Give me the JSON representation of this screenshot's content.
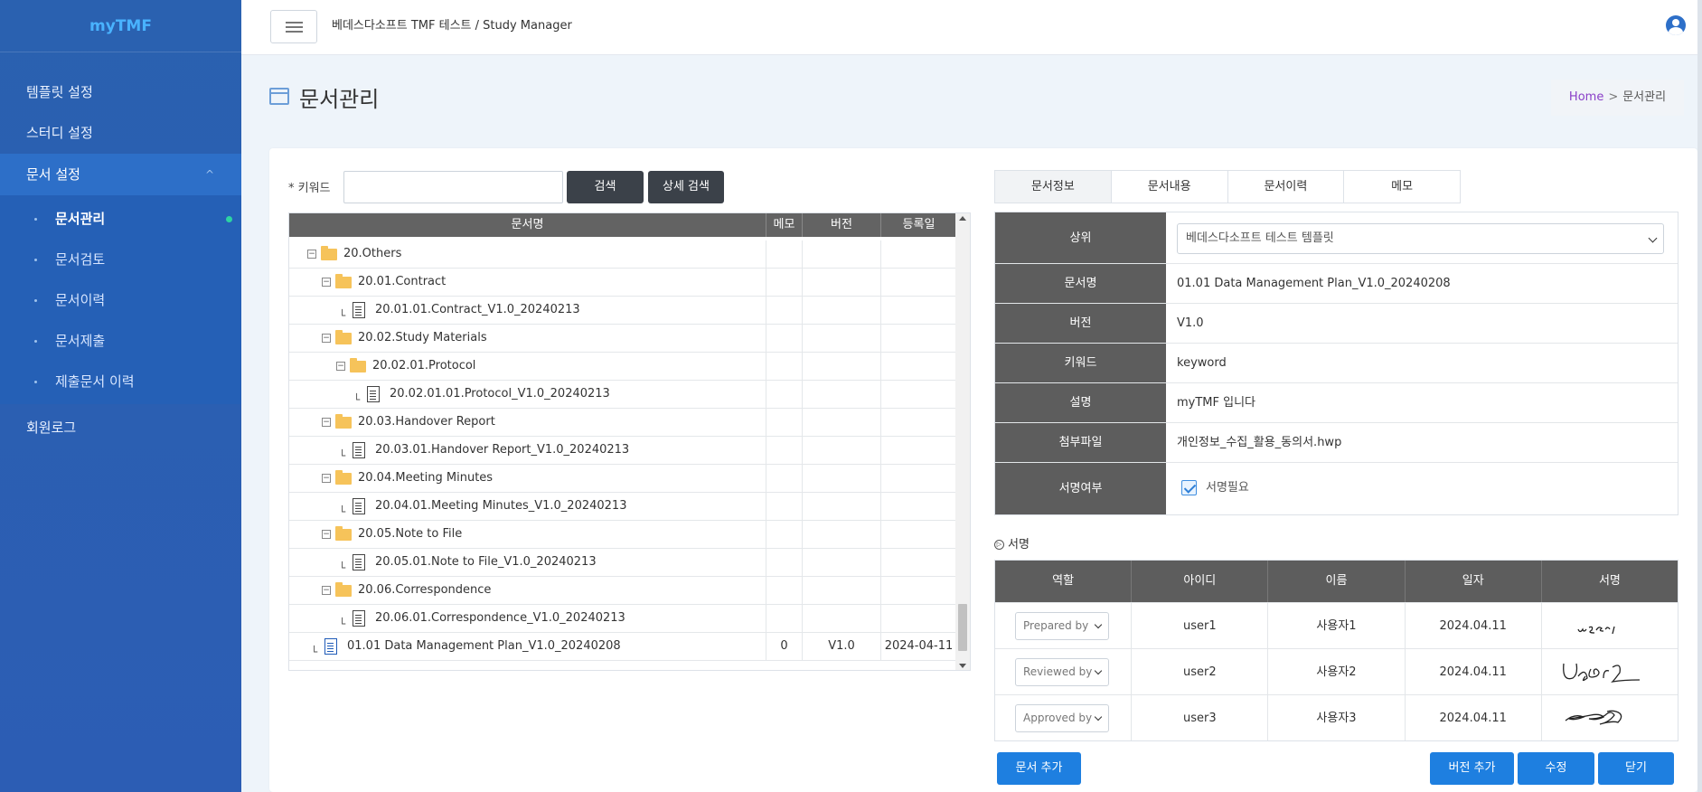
{
  "brand": "myTMF",
  "sidebar": {
    "items": [
      {
        "label": "템플릿 설정"
      },
      {
        "label": "스터디 설정"
      },
      {
        "label": "문서 설정",
        "expanded": true
      },
      {
        "label": "회원로그"
      }
    ],
    "submenu": [
      {
        "label": "문서관리",
        "active": true
      },
      {
        "label": "문서검토"
      },
      {
        "label": "문서이력"
      },
      {
        "label": "문서제출"
      },
      {
        "label": "제출문서 이력"
      }
    ]
  },
  "topbar": {
    "title": "베데스다소프트 TMF 테스트 / Study Manager"
  },
  "page": {
    "title": "문서관리",
    "breadcrumb": {
      "home": "Home",
      "current": "문서관리"
    }
  },
  "search": {
    "keyword_label": "* 키워드",
    "keyword_value": "",
    "search_button": "검색",
    "advanced_button": "상세 검색"
  },
  "tree": {
    "columns": [
      "문서명",
      "메모",
      "버전",
      "등록일"
    ],
    "rows": [
      {
        "type": "folder",
        "level": 0,
        "label": "20.Others"
      },
      {
        "type": "folder",
        "level": 1,
        "label": "20.01.Contract"
      },
      {
        "type": "doc",
        "level": 2,
        "label": "20.01.01.Contract_V1.0_20240213"
      },
      {
        "type": "folder",
        "level": 1,
        "label": "20.02.Study Materials"
      },
      {
        "type": "folder",
        "level": 2,
        "label": "20.02.01.Protocol"
      },
      {
        "type": "doc",
        "level": 3,
        "label": "20.02.01.01.Protocol_V1.0_20240213"
      },
      {
        "type": "folder",
        "level": 1,
        "label": "20.03.Handover Report"
      },
      {
        "type": "doc",
        "level": 2,
        "label": "20.03.01.Handover Report_V1.0_20240213"
      },
      {
        "type": "folder",
        "level": 1,
        "label": "20.04.Meeting Minutes"
      },
      {
        "type": "doc",
        "level": 2,
        "label": "20.04.01.Meeting Minutes_V1.0_20240213"
      },
      {
        "type": "folder",
        "level": 1,
        "label": "20.05.Note to File"
      },
      {
        "type": "doc",
        "level": 2,
        "label": "20.05.01.Note to File_V1.0_20240213"
      },
      {
        "type": "folder",
        "level": 1,
        "label": "20.06.Correspondence"
      },
      {
        "type": "doc",
        "level": 2,
        "label": "20.06.01.Correspondence_V1.0_20240213"
      },
      {
        "type": "rootdoc",
        "level": 0,
        "label": "01.01 Data Management Plan_V1.0_20240208",
        "memo": "0",
        "version": "V1.0",
        "date": "2024-04-11"
      }
    ]
  },
  "tabs": [
    "문서정보",
    "문서내용",
    "문서이력",
    "메모"
  ],
  "info": {
    "parent_label": "상위",
    "parent_value": "베데스다소프트 테스트 템플릿",
    "name_label": "문서명",
    "name_value": "01.01 Data Management Plan_V1.0_20240208",
    "version_label": "버전",
    "version_value": "V1.0",
    "keyword_label": "키워드",
    "keyword_value": "keyword",
    "desc_label": "설명",
    "desc_value": "myTMF 입니다",
    "file_label": "첨부파일",
    "file_value": "개인정보_수집_활용_동의서.hwp",
    "sign_label": "서명여부",
    "sign_check_label": "서명필요",
    "sign_required": true
  },
  "signature": {
    "title": "서명",
    "columns": [
      "역할",
      "아이디",
      "이름",
      "일자",
      "서명"
    ],
    "rows": [
      {
        "role": "Prepared by",
        "id": "user1",
        "name": "사용자1",
        "date": "2024.04.11"
      },
      {
        "role": "Reviewed by",
        "id": "user2",
        "name": "사용자2",
        "date": "2024.04.11"
      },
      {
        "role": "Approved by",
        "id": "user3",
        "name": "사용자3",
        "date": "2024.04.11"
      }
    ]
  },
  "buttons": {
    "add_doc": "문서 추가",
    "add_version": "버전 추가",
    "edit": "수정",
    "close": "닫기"
  },
  "colors": {
    "sidebar": "#2a61b0",
    "brand": "#49b3ff",
    "primary": "#1e7fe0",
    "header_gray": "#5d5d5d"
  }
}
